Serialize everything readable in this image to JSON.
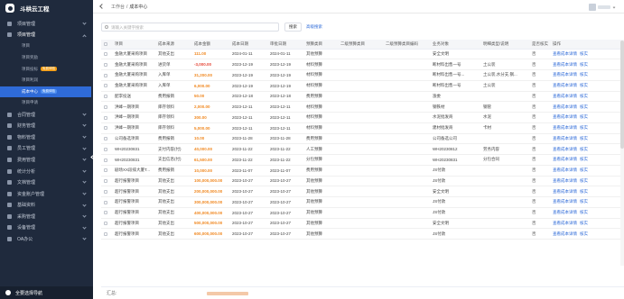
{
  "app": {
    "title": "斗栱云工程"
  },
  "sidebar": {
    "items": [
      {
        "label": "项目管理",
        "open": false
      },
      {
        "label": "项目管理",
        "open": true
      }
    ],
    "sub_items": [
      {
        "label": "项目",
        "badge": "",
        "active": false
      },
      {
        "label": "项目奖励",
        "badge": "",
        "active": false
      },
      {
        "label": "项目投标",
        "badge": "免费体验",
        "badge_color": "orange",
        "active": false
      },
      {
        "label": "项目利润",
        "badge": "",
        "active": false
      },
      {
        "label": "成本中心",
        "badge": "免费体验",
        "badge_color": "blue",
        "active": true
      },
      {
        "label": "项目申请",
        "badge": "",
        "active": false
      }
    ],
    "items_after": [
      {
        "label": "合同管理"
      },
      {
        "label": "财务管理"
      },
      {
        "label": "物料管理"
      },
      {
        "label": "员工管理"
      },
      {
        "label": "费用管理"
      },
      {
        "label": "统计分析"
      },
      {
        "label": "文档管理"
      },
      {
        "label": "资金账户管理"
      },
      {
        "label": "基础资料"
      },
      {
        "label": "采购管理"
      },
      {
        "label": "设备管理"
      },
      {
        "label": "OA办公"
      }
    ],
    "account_label": "全要选择导航"
  },
  "header": {
    "breadcrumb": [
      "工作台",
      "成本中心"
    ]
  },
  "toolbar": {
    "search_placeholder": "请输入关键字搜索",
    "search_button": "搜索",
    "reset_link": "高级搜索"
  },
  "table": {
    "columns": [
      "项目",
      "成本来源",
      "成本金额",
      "成本日期",
      "审批日期",
      "预算类目",
      "二级预算类目",
      "二级预算类目编码",
      "业务对象",
      "明细类型/说明",
      "是否核实",
      "操作"
    ],
    "rows": [
      [
        "金融大厦采购项目",
        "其他支出",
        "111.00",
        "2024-01-11",
        "2024-01-11",
        "其他预算",
        "",
        "",
        "安全文明",
        "",
        "否",
        "orange"
      ],
      [
        "金融大厦采购项目",
        "进货单",
        "-3,000.00",
        "2023-12-19",
        "2023-12-19",
        "材料预算",
        "",
        "",
        "断材料出售一号",
        "土公装",
        "否",
        "red"
      ],
      [
        "金融大厦采购项目",
        "入库单",
        "31,200.00",
        "2023-12-19",
        "2023-12-19",
        "材料预算",
        "",
        "",
        "断材料出售一号...",
        "土公装,水分支,钢...",
        "否",
        "orange"
      ],
      [
        "金融大厦采购项目",
        "入库单",
        "6,000.00",
        "2023-12-19",
        "2023-12-19",
        "材料预算",
        "",
        "",
        "断材料出售一号",
        "土公装",
        "否",
        "orange"
      ],
      [
        "配李投送",
        "费用报销",
        "50.00",
        "2023-12-18",
        "2023-12-18",
        "费用预算",
        "",
        "",
        "涨委",
        "",
        "否",
        "orange"
      ],
      [
        "洪峰一期项目",
        "库存领料",
        "2,000.00",
        "2023-12-11",
        "2023-12-11",
        "材料预算",
        "",
        "",
        "钢铁材",
        "钢管",
        "否",
        "orange"
      ],
      [
        "洪峰一期项目",
        "库存领料",
        "300.00",
        "2023-12-11",
        "2023-12-11",
        "材料预算",
        "",
        "",
        "水泥批发商",
        "水泥",
        "否",
        "orange"
      ],
      [
        "洪峰一期项目",
        "库存领料",
        "5,000.00",
        "2023-12-11",
        "2023-12-11",
        "材料预算",
        "",
        "",
        "建材批发商",
        "卡材",
        "否",
        "orange"
      ],
      [
        "公司备选项目",
        "费用报销",
        "10.00",
        "2023-11-28",
        "2023-11-28",
        "费用预算",
        "",
        "",
        "公司备选公司",
        "",
        "否",
        "orange"
      ],
      [
        "WH20230831",
        "支付内容(付)",
        "40,000.00",
        "2023-11-22",
        "2023-11-22",
        "人工预算",
        "",
        "",
        "WH20230812",
        "劳务内容",
        "否",
        "orange"
      ],
      [
        "WH20230831",
        "支出信息(付)",
        "61,500.00",
        "2023-11-22",
        "2023-11-22",
        "分包预算",
        "",
        "",
        "WH20230831",
        "分包合同",
        "否",
        "orange"
      ],
      [
        "剧场XX段排大厦T...",
        "费用报销",
        "10,000.00",
        "2023-11-07",
        "2023-11-07",
        "费用预算",
        "",
        "",
        "JS付款",
        "",
        "否",
        "orange"
      ],
      [
        "超行报警项目",
        "其他支出",
        "100,000,000.00",
        "2023-10-27",
        "2023-10-27",
        "其他预算",
        "",
        "",
        "JS付款",
        "",
        "否",
        "orange"
      ],
      [
        "超行报警项目",
        "其他支出",
        "200,000,000.00",
        "2023-10-27",
        "2023-10-27",
        "其他预算",
        "",
        "",
        "安全文明",
        "",
        "否",
        "orange"
      ],
      [
        "超行报警项目",
        "其他支出",
        "300,000,000.00",
        "2023-10-27",
        "2023-10-27",
        "其他预算",
        "",
        "",
        "JS付款",
        "",
        "否",
        "orange"
      ],
      [
        "超行报警项目",
        "其他支出",
        "400,000,000.00",
        "2023-10-27",
        "2023-10-27",
        "其他预算",
        "",
        "",
        "JS付款",
        "",
        "否",
        "orange"
      ],
      [
        "超行报警项目",
        "其他支出",
        "500,000,000.00",
        "2023-10-27",
        "2023-10-27",
        "其他预算",
        "",
        "",
        "安全文明",
        "",
        "否",
        "orange"
      ],
      [
        "超行报警项目",
        "其他支出",
        "600,000,000.00",
        "2023-10-27",
        "2023-10-27",
        "其他预算",
        "",
        "",
        "JS付款",
        "",
        "否",
        "orange"
      ]
    ],
    "row_actions": [
      "查看成本详情",
      "核实"
    ]
  },
  "footer": {
    "summary_label": "汇总:"
  },
  "colors": {
    "sidebar_bg": "#1f2a3d",
    "accent": "#2f6bd8",
    "amount_orange": "#f08a24",
    "amount_red": "#e64a3b"
  }
}
